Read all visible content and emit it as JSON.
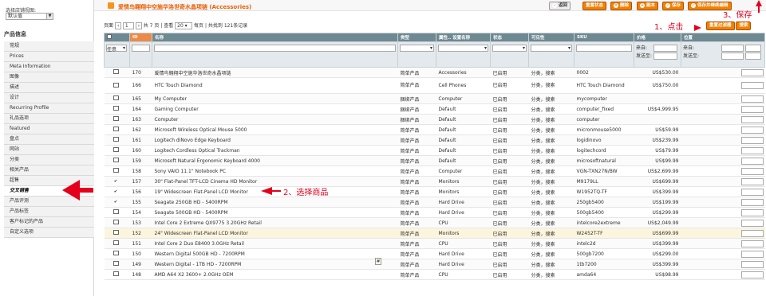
{
  "sidebar": {
    "store_label": "选择店铺视图:",
    "store_value": "默认值",
    "section_title": "产品信息",
    "items": [
      "常规",
      "Prices",
      "Meta Information",
      "图像",
      "描述",
      "设计",
      "Recurring Profile",
      "礼品选项",
      "featured",
      "盘点",
      "网站",
      "分类",
      "相关产品",
      "超售",
      "交叉销售",
      "产品评测",
      "产品标签",
      "客户标记的产品",
      "自定义选项"
    ],
    "active_index": 14
  },
  "header": {
    "title": "爱情鸟翱翔中空施华洛世奇水晶项链 (Accessories)",
    "buttons": {
      "back": "返回",
      "reset": "重置状态",
      "delete": "删除",
      "duplicate": "副本",
      "save": "保存",
      "save_continue": "保存并继续编辑"
    }
  },
  "pager": {
    "page_label": "页面",
    "page_value": "1",
    "of_pages": "共 7 页",
    "view_label": "| 查看",
    "per_page": "20",
    "per_page_suffix": "每页",
    "total": "| 共找到 121条记录"
  },
  "grid_actions": {
    "reset_filter": "重置过滤器",
    "search": "搜索"
  },
  "columns": [
    "",
    "ID",
    "名称",
    "类型",
    "属性.. 设置名称",
    "状态",
    "可见性",
    "SKU",
    "价格",
    "位置"
  ],
  "filter": {
    "any_label": "任意",
    "price_from": "来自:",
    "price_to": "发送至:",
    "id_from": "来自:",
    "id_to": "发送至:"
  },
  "rows": [
    {
      "checked": false,
      "id": "170",
      "name": "爱情鸟翱翔中空施华洛世奇水晶项链",
      "type": "简单产品",
      "set": "Accessories",
      "status": "已启用",
      "visibility": "分类，搜索",
      "sku": "0002",
      "price": "US$530.00"
    },
    {
      "checked": false,
      "id": "166",
      "name": "HTC Touch Diamond",
      "type": "简单产品",
      "set": "Cell Phones",
      "status": "已启用",
      "visibility": "分类，搜索",
      "sku": "HTC Touch Diamond",
      "price": "US$750.00"
    },
    {
      "checked": false,
      "id": "165",
      "name": "My Computer",
      "type": "捆绑产品",
      "set": "Computer",
      "status": "已启用",
      "visibility": "分类，搜索",
      "sku": "mycomputer",
      "price": ""
    },
    {
      "checked": false,
      "id": "164",
      "name": "Gaming Computer",
      "type": "捆绑产品",
      "set": "Default",
      "status": "已启用",
      "visibility": "分类，搜索",
      "sku": "computer_fixed",
      "price": "US$4,999.95"
    },
    {
      "checked": false,
      "id": "163",
      "name": "Computer",
      "type": "捆绑产品",
      "set": "Default",
      "status": "已启用",
      "visibility": "分类，搜索",
      "sku": "computer",
      "price": ""
    },
    {
      "checked": false,
      "id": "162",
      "name": "Microsoft Wireless Optical Mouse 5000",
      "type": "简单产品",
      "set": "Default",
      "status": "已启用",
      "visibility": "分类，搜索",
      "sku": "micronmouse5000",
      "price": "US$59.99"
    },
    {
      "checked": false,
      "id": "161",
      "name": "Logitech diNovo Edge Keyboard",
      "type": "简单产品",
      "set": "Default",
      "status": "已启用",
      "visibility": "分类，搜索",
      "sku": "logidinovo",
      "price": "US$239.99"
    },
    {
      "checked": false,
      "id": "160",
      "name": "Logitech Cordless Optical Trackman",
      "type": "简单产品",
      "set": "Default",
      "status": "已启用",
      "visibility": "分类，搜索",
      "sku": "logitechcord",
      "price": "US$79.99"
    },
    {
      "checked": false,
      "id": "159",
      "name": "Microsoft Natural Ergonomic Keyboard 4000",
      "type": "简单产品",
      "set": "Default",
      "status": "已启用",
      "visibility": "分类，搜索",
      "sku": "microsoftnatural",
      "price": "US$99.99"
    },
    {
      "checked": false,
      "id": "158",
      "name": "Sony VAIO 11.1\" Notebook PC",
      "type": "简单产品",
      "set": "Computer",
      "status": "已启用",
      "visibility": "分类，搜索",
      "sku": "VGN-TXN27N/BW",
      "price": "US$2,699.99"
    },
    {
      "checked": true,
      "id": "157",
      "name": "30\" Flat-Panel TFT-LCD Cinema HD Monitor",
      "type": "简单产品",
      "set": "Monitors",
      "status": "已启用",
      "visibility": "分类，搜索",
      "sku": "M9179LL",
      "price": "US$699.99"
    },
    {
      "checked": true,
      "id": "156",
      "name": "19\" Widescreen Flat-Panel LCD Monitor",
      "type": "简单产品",
      "set": "Monitors",
      "status": "已启用",
      "visibility": "分类，搜索",
      "sku": "W1952TQ-TF",
      "price": "US$399.99"
    },
    {
      "checked": true,
      "id": "155",
      "name": "Seagate 250GB HD - 5400RPM",
      "type": "简单产品",
      "set": "Hard Drive",
      "status": "已启用",
      "visibility": "分类，搜索",
      "sku": "250gb5400",
      "price": "US$199.99"
    },
    {
      "checked": false,
      "id": "154",
      "name": "Seagate 500GB HD - 5400RPM",
      "type": "简单产品",
      "set": "Hard Drive",
      "status": "已启用",
      "visibility": "分类，搜索",
      "sku": "500gb5400",
      "price": "US$299.99"
    },
    {
      "checked": false,
      "id": "153",
      "name": "Intel Core 2 Extreme QX9775 3.20GHz Retail",
      "type": "简单产品",
      "set": "CPU",
      "status": "已启用",
      "visibility": "分类，搜索",
      "sku": "intelcore2extreme",
      "price": "US$2,049.99"
    },
    {
      "checked": false,
      "id": "152",
      "name": "24\" Widescreen Flat-Panel LCD Monitor",
      "type": "简单产品",
      "set": "Monitors",
      "status": "已启用",
      "visibility": "分类，搜索",
      "sku": "W2452T-TF",
      "price": "US$699.99"
    },
    {
      "checked": false,
      "id": "151",
      "name": "Intel Core 2 Duo E8400 3.0GHz Retail",
      "type": "简单产品",
      "set": "CPU",
      "status": "已启用",
      "visibility": "分类，搜索",
      "sku": "intelc2d",
      "price": "US$399.99"
    },
    {
      "checked": false,
      "id": "150",
      "name": "Western Digital 500GB HD - 7200RPM",
      "type": "简单产品",
      "set": "Hard Drive",
      "status": "已启用",
      "visibility": "分类，搜索",
      "sku": "500gb7200",
      "price": "US$299.00"
    },
    {
      "checked": false,
      "id": "149",
      "name": "Western Digital - 1TB HD - 7200RPM",
      "type": "简单产品",
      "set": "Hard Drive",
      "status": "已启用",
      "visibility": "分类，搜索",
      "sku": "1tb7200",
      "price": "US$399.99"
    },
    {
      "checked": false,
      "id": "148",
      "name": "AMD A64 X2 3600+ 2.0GHz OEM",
      "type": "简单产品",
      "set": "CPU",
      "status": "已启用",
      "visibility": "分类，搜索",
      "sku": "amda64",
      "price": "US$98.99"
    }
  ],
  "annotations": {
    "click": "1、点击",
    "save": "3、保存",
    "select": "2、选择商品"
  },
  "colors": {
    "accent": "#eb5e00",
    "header_bg": "#6f8992",
    "annotation": "#e5001b"
  }
}
